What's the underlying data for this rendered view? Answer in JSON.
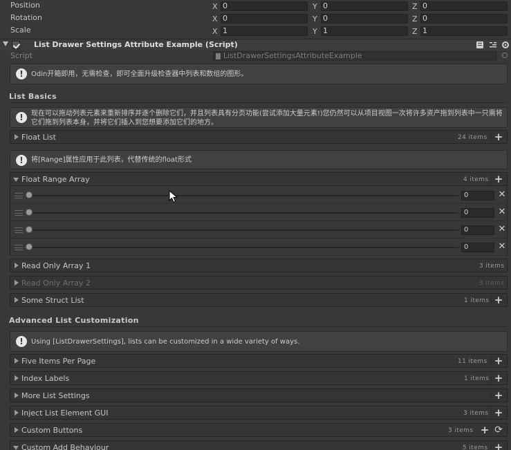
{
  "transform": {
    "rows": [
      {
        "label": "Position",
        "x": "0",
        "y": "0",
        "z": "0"
      },
      {
        "label": "Rotation",
        "x": "0",
        "y": "0",
        "z": "0"
      },
      {
        "label": "Scale",
        "x": "1",
        "y": "1",
        "z": "1"
      }
    ],
    "axis_labels": {
      "x": "X",
      "y": "Y",
      "z": "Z"
    }
  },
  "component": {
    "title": "List Drawer Settings Attribute Example (Script)",
    "script_label": "Script",
    "script_value": "ListDrawerSettingsAttributeExample",
    "enabled": true
  },
  "intro_info": "Odin开箱即用，无需检查，即可全面升级检查器中列表和数组的图形。",
  "list_basics": {
    "title": "List Basics",
    "info": "现在可以拖动列表元素来重新排序并逐个删除它们，并且列表具有分页功能(尝试添加大量元素!)您仍然可以从项目视图一次将许多资产拖到列表中一只需将它们拖到列表本身，并将它们插入到您想要添加它们的地方。",
    "float_list": {
      "label": "Float List",
      "count": "24 items"
    },
    "range_info": "将[Range]属性应用于此列表，代替传统的float形式",
    "float_range_array": {
      "label": "Float Range Array",
      "count": "4 items",
      "elements": [
        {
          "value": "0",
          "fraction": 0
        },
        {
          "value": "0",
          "fraction": 0
        },
        {
          "value": "0",
          "fraction": 0
        },
        {
          "value": "0",
          "fraction": 0
        }
      ]
    },
    "read_only_1": {
      "label": "Read Only Array 1",
      "count": "3 items"
    },
    "read_only_2": {
      "label": "Read Only Array 2",
      "count": "3 items"
    },
    "some_struct_list": {
      "label": "Some Struct List",
      "count": "1 items"
    }
  },
  "advanced": {
    "title": "Advanced List Customization",
    "info": "Using [ListDrawerSettings], lists can be customized in a wide variety of ways.",
    "lists": [
      {
        "label": "Five Items Per Page",
        "count": "11 items"
      },
      {
        "label": "Index Labels",
        "count": "1 items"
      },
      {
        "label": "More List Settings",
        "count": ""
      },
      {
        "label": "Inject List Element GUI",
        "count": "3 items"
      },
      {
        "label": "Custom Buttons",
        "count": "3 items"
      },
      {
        "label": "Custom Add Behaviour",
        "count": "5 items"
      }
    ]
  },
  "icons": {
    "foldout": "triangle-icon",
    "info": "info-icon",
    "add": "plus-icon",
    "remove": "close-icon",
    "refresh": "refresh-icon",
    "help": "help-book-icon",
    "preset": "preset-icon",
    "gear": "gear-icon",
    "drag": "drag-handle-icon",
    "script_file": "script-file-icon",
    "cursor": "mouse-cursor-icon"
  },
  "colors": {
    "background": "#383838",
    "header": "#353535",
    "text": "#c8c8c8",
    "dim_text": "#6e6e6e"
  }
}
